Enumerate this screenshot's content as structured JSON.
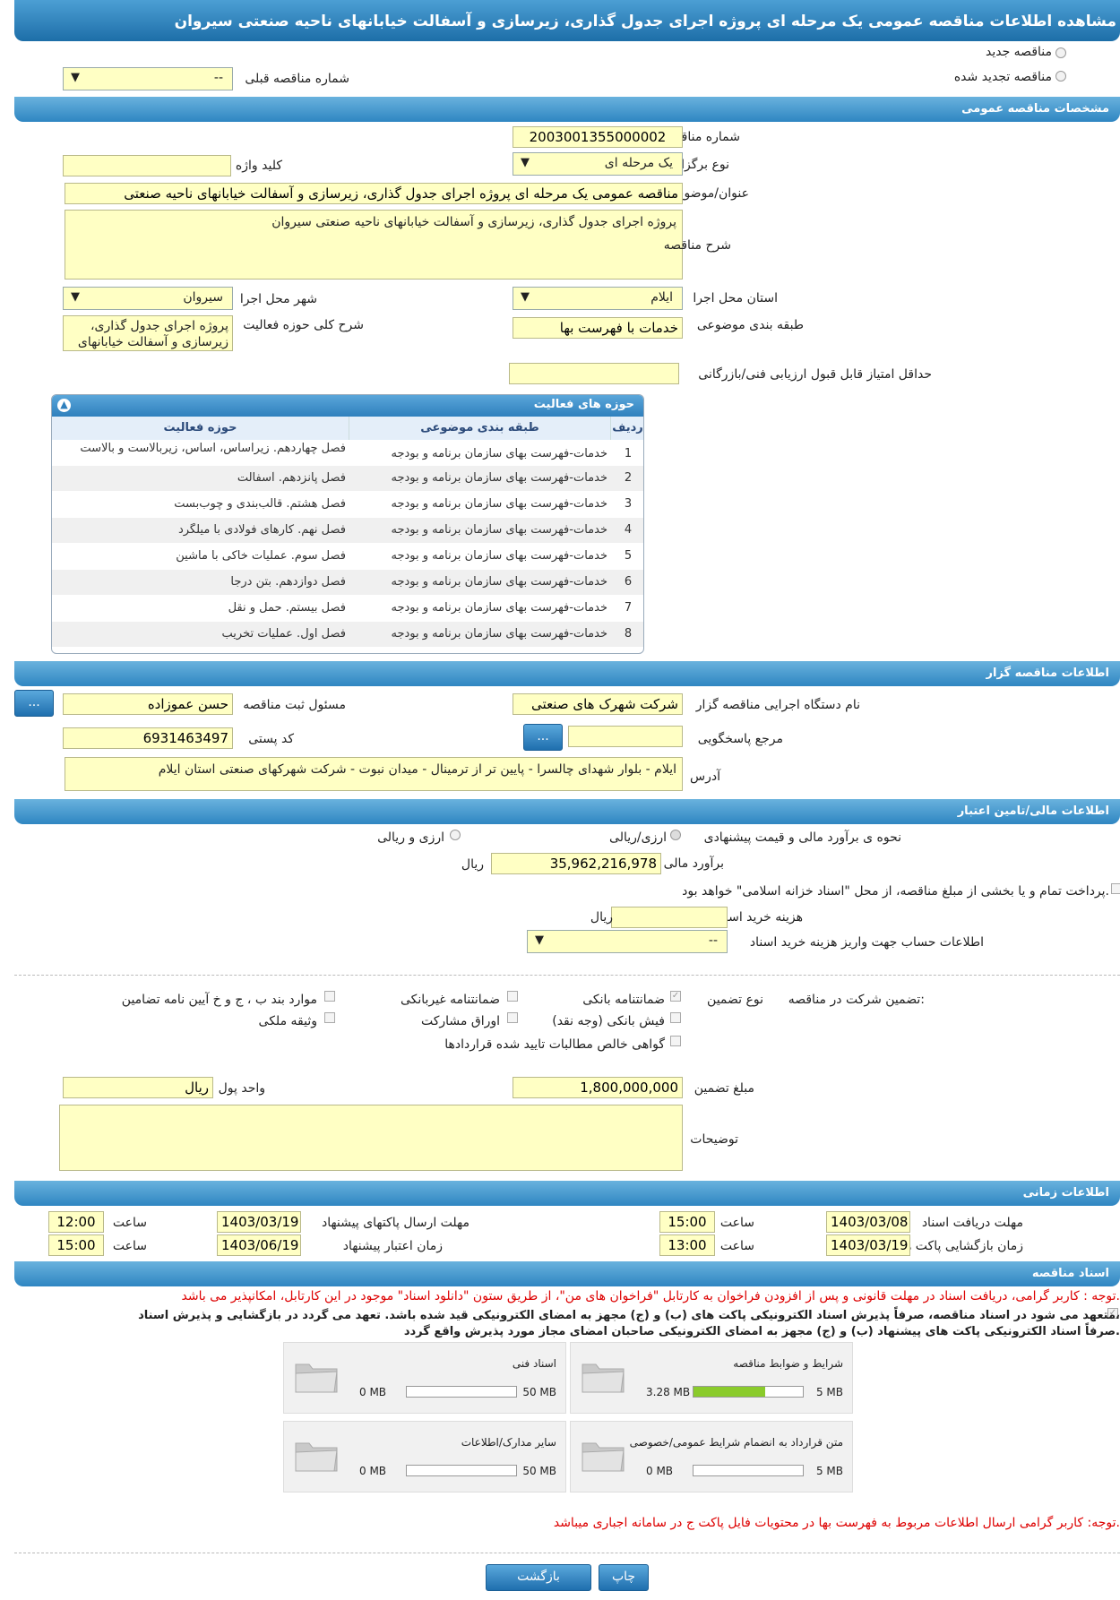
{
  "header": {
    "title": "مشاهده اطلاعات مناقصه عمومی یک مرحله ای پروژه اجرای جدول گذاری، زیرسازی و آسفالت خیابانهای ناحیه صنعتی سیروان"
  },
  "tender_type": {
    "new": "مناقصه جدید",
    "renewed": "مناقصه تجدید شده",
    "prev_label": "شماره مناقصه قبلی",
    "prev_value": "--"
  },
  "general": {
    "section": "مشخصات مناقصه عمومی",
    "number_label": "شماره مناقصه",
    "number": "2003001355000002",
    "method_label": "نوع برگزاری",
    "method": "یک مرحله ای",
    "keyword_label": "کلید واژه",
    "keyword": "",
    "subject_label": "عنوان/موضوع مناقصه",
    "subject": "مناقصه عمومی یک مرحله ای پروژه اجرای جدول گذاری، زیرسازی و  آسفالت خیابانهای ناحیه صنعتی",
    "desc_label": "شرح مناقصه",
    "desc": "پروژه اجرای جدول گذاری، زیرسازی و  آسفالت خیابانهای ناحیه صنعتی سیروان",
    "province_label": "استان محل اجرا",
    "province": "ایلام",
    "city_label": "شهر محل اجرا",
    "city": "سیروان",
    "category_label": "طبقه بندی موضوعی",
    "category": "خدمات با فهرست بها",
    "activity_label": "شرح کلی حوزه فعالیت",
    "activity": "پروژه اجرای جدول گذاری، زیرسازی و  آسفالت خیابانهای",
    "minscore_label": "حداقل امتیاز قابل قبول ارزیابی فنی/بازرگانی",
    "minscore": ""
  },
  "activities": {
    "title": "حوزه های فعالیت",
    "cols": [
      "ردیف",
      "طبقه بندی موضوعی",
      "حوزه فعالیت"
    ],
    "rows": [
      {
        "n": "1",
        "cat": "خدمات-فهرست بهای سازمان برنامه و بودجه",
        "act": "فصل چهاردهم. زیراساس، اساس، زیربالاست  و بالاست"
      },
      {
        "n": "2",
        "cat": "خدمات-فهرست بهای سازمان برنامه و بودجه",
        "act": "فصل پانزدهم. آسفالت"
      },
      {
        "n": "3",
        "cat": "خدمات-فهرست بهای سازمان برنامه و بودجه",
        "act": "فصل هشتم. قالب‌بندی و چوب‌بست"
      },
      {
        "n": "4",
        "cat": "خدمات-فهرست بهای سازمان برنامه و بودجه",
        "act": "فصل نهم. کارهای فولادی با میلگرد"
      },
      {
        "n": "5",
        "cat": "خدمات-فهرست بهای سازمان برنامه و بودجه",
        "act": "فصل سوم. عملیات خاکی با ماشین"
      },
      {
        "n": "6",
        "cat": "خدمات-فهرست بهای سازمان برنامه و بودجه",
        "act": "فصل دوازدهم. بتن درجا"
      },
      {
        "n": "7",
        "cat": "خدمات-فهرست بهای سازمان برنامه و بودجه",
        "act": "فصل بیستم. حمل و نقل"
      },
      {
        "n": "8",
        "cat": "خدمات-فهرست بهای سازمان برنامه و بودجه",
        "act": "فصل اول. عملیات تخریب"
      }
    ]
  },
  "organizer": {
    "section": "اطلاعات مناقصه گزار",
    "agency_label": "نام دستگاه اجرایی مناقصه گزار",
    "agency": "شرکت شهرک های صنعتی",
    "responsible_label": "مسئول ثبت مناقصه",
    "responsible": "حسن عموزاده",
    "ref_label": "مرجع پاسخگویی",
    "ref": "",
    "postal_label": "کد پستی",
    "postal": "6931463497",
    "address_label": "آدرس",
    "address": "ایلام - بلوار شهدای چالسرا - پایین تر از ترمینال - میدان نبوت - شرکت شهرکهای صنعتی استان ایلام",
    "btn": "..."
  },
  "finance": {
    "section": "اطلاعات مالی/تامین اعتبار",
    "method_label": "نحوه ی برآورد مالی و قیمت پیشنهادی",
    "opt1": "ارزی/ریالی",
    "opt2": "ارزی و ریالی",
    "estimate_label": "برآورد مالی",
    "estimate": "35,962,216,978",
    "unit": "ریال",
    "treasury": "پرداخت تمام و یا بخشی از مبلغ مناقصه، از محل \"اسناد خزانه اسلامی\" خواهد بود.",
    "doc_cost_label": "هزینه خرید اسناد",
    "doc_cost_unit": "ریال",
    "doc_cost": "",
    "account_label": "اطلاعات حساب جهت واریز هزینه خرید اسناد",
    "account": "--"
  },
  "guarantee": {
    "label": "تضمین شرکت در مناقصه:",
    "type_label": "نوع تضمین",
    "items": [
      "ضمانتنامه بانکی",
      "ضمانتنامه غیربانکی",
      "موارد بند ب ، ج و خ آیین نامه تضامین",
      "فیش بانکی (وجه نقد)",
      "اوراق مشارکت",
      "وثیقه ملکی",
      "گواهی خالص مطالبات تایید شده قراردادها"
    ],
    "amount_label": "مبلغ تضمین",
    "amount": "1,800,000,000",
    "currency_label": "واحد پول",
    "currency": "ریال",
    "notes_label": "توضیحات",
    "notes": ""
  },
  "timing": {
    "section": "اطلاعات زمانی",
    "receive_label": "مهلت دریافت اسناد",
    "receive_date": "1403/03/08",
    "receive_time": "15:00",
    "send_label": "مهلت ارسال پاکتهای پیشنهاد",
    "send_date": "1403/03/19",
    "send_time": "12:00",
    "open_label": "زمان بازگشایی پاکت ها",
    "open_date": "1403/03/19",
    "open_time": "13:00",
    "valid_label": "زمان اعتبار پیشنهاد",
    "valid_date": "1403/06/19",
    "valid_time": "15:00",
    "time_label": "ساعت"
  },
  "documents": {
    "section": "اسناد مناقصه",
    "note1": "توجه : کاربر گرامی، دریافت اسناد در مهلت قانونی و پس از افزودن فراخوان به کارتابل \"فراخوان های من\"، از طریق ستون \"دانلود اسناد\" موجود در این کارتابل، امکانپذیر می باشد.",
    "commit1": "متعهد می شود در اسناد مناقصه، صرفاً پذیرش اسناد الکترونیکی پاکت های (ب) و (ج) مجهز به امضای الکترونیکی قید شده باشد. تعهد می گردد در بازگشایی و پذیرش اسناد،",
    "commit2": "صرفاً اسناد الکترونیکی پاکت های پیشنهاد (ب) و (ج) مجهز به امضای الکترونیکی صاحبان امضای مجاز مورد پذیرش واقع گردد.",
    "cards": [
      {
        "title": "شرایط و ضوابط مناقصه",
        "cur": "3.28 MB",
        "max": "5 MB",
        "fill": 0.656
      },
      {
        "title": "اسناد فنی",
        "cur": "0 MB",
        "max": "50 MB",
        "fill": 0
      },
      {
        "title": "متن قرارداد به انضمام شرایط عمومی/خصوصی",
        "cur": "0 MB",
        "max": "5 MB",
        "fill": 0
      },
      {
        "title": "سایر مدارک/اطلاعات",
        "cur": "0 MB",
        "max": "50 MB",
        "fill": 0
      }
    ],
    "note2": "توجه: کاربر گرامی ارسال اطلاعات مربوط به فهرست بها در محتویات فایل پاکت ج در سامانه اجباری میباشد."
  },
  "footer": {
    "print": "چاپ",
    "back": "بازگشت"
  }
}
